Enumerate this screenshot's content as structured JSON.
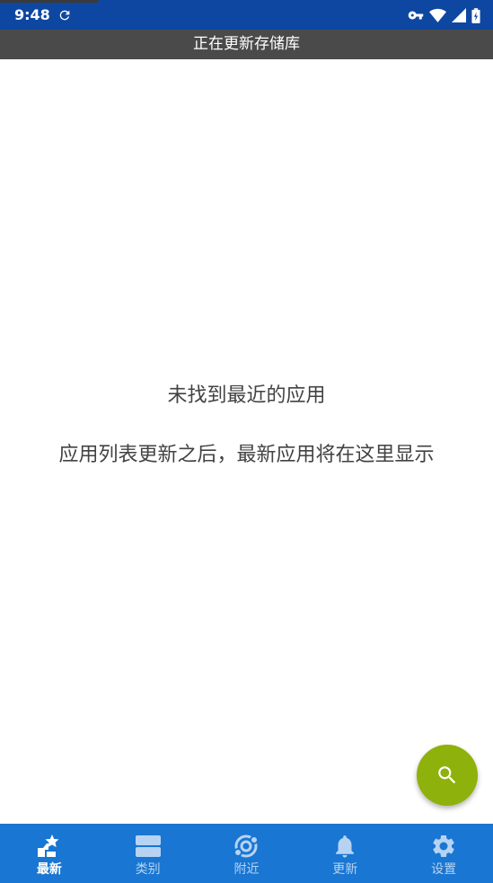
{
  "status_bar": {
    "time": "9:48",
    "color": "#0d47a1",
    "icons": [
      "sync-icon",
      "vpn-key-icon",
      "wifi-icon",
      "cell-signal-icon",
      "battery-charging-icon"
    ]
  },
  "banner": {
    "text": "正在更新存储库",
    "color": "#4a4a4a"
  },
  "empty_state": {
    "title": "未找到最近的应用",
    "description": "应用列表更新之后，最新应用将在这里显示"
  },
  "fab": {
    "icon": "search-icon",
    "color": "#8fb10c"
  },
  "bottom_nav": {
    "color": "#1976d2",
    "items": [
      {
        "label": "最新",
        "icon": "whats-new-icon",
        "active": true
      },
      {
        "label": "类别",
        "icon": "categories-icon",
        "active": false
      },
      {
        "label": "附近",
        "icon": "nearby-icon",
        "active": false
      },
      {
        "label": "更新",
        "icon": "notification-bell-icon",
        "active": false
      },
      {
        "label": "设置",
        "icon": "settings-gear-icon",
        "active": false
      }
    ]
  }
}
